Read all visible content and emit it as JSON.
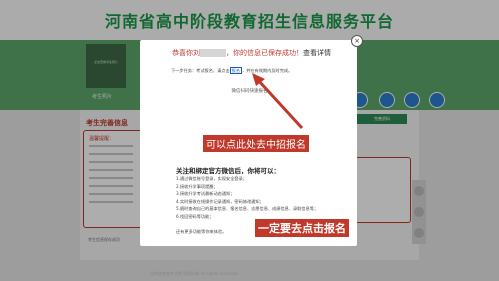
{
  "header": {
    "title": "河南省高中阶段教育招生信息服务平台"
  },
  "nav": {
    "photo_text": "点击查看考生照片",
    "candidate_label": "考生照片",
    "icons": [
      "circle-icon",
      "circle-icon",
      "user-icon",
      "power-icon"
    ]
  },
  "page": {
    "section_title": "考生完善信息",
    "warning_title": "温馨提醒：",
    "side_button": "完善资料",
    "below_text": "考生信息保存成功"
  },
  "modal": {
    "title_prefix": "恭喜你刘",
    "title_suffix": "，你的信息已保存成功！",
    "title_view": "查看详情",
    "next_prefix": "下一步任务：考试报名，请点击",
    "next_link": "报名",
    "next_suffix": "，并在有效期内及时完成。",
    "qr_hint": "微信扫码快速报名",
    "follow_title": "关注和绑定官方微信后，你将可以：",
    "benefits": [
      "1.通过微信账号登录，实现安全登录；",
      "2.接收升学事项提醒；",
      "3.接收升学考试最新动态通知；",
      "4.实时接收在线操作记录通知，密码修改通知；",
      "5.随时查询自己的基本信息、报名信息、志愿信息、成绩信息、录取信息等；",
      "6.找回密码等功能；"
    ],
    "more": "还有更多功能等你来体验。"
  },
  "annotations": {
    "click_here": "可以点此处去中招报名",
    "must_register": "一定要去点击报名"
  },
  "footer": {
    "text": "河南省教育考试院 版权所有 All rights reserved"
  },
  "colors": {
    "accent": "#c0392b",
    "nav_green": "#5fa86e",
    "title_green": "#1a9a4a",
    "link_blue": "#1a5fb4"
  }
}
